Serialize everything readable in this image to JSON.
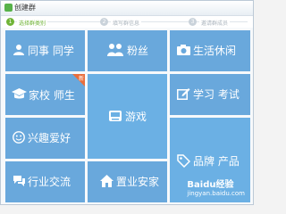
{
  "window": {
    "title": "创建群"
  },
  "steps": [
    {
      "num": "1",
      "label": "选择群类别",
      "active": true
    },
    {
      "num": "2",
      "label": "填写群信息",
      "active": false
    },
    {
      "num": "3",
      "label": "邀请群成员",
      "active": false
    }
  ],
  "tiles": {
    "colleagues": {
      "label": "同事 同学",
      "icon": "people-icon"
    },
    "fans": {
      "label": "粉丝",
      "icon": "fans-icon"
    },
    "hobbies": {
      "label": "生活休闲",
      "icon": "camera-icon"
    },
    "school": {
      "label": "家校 师生",
      "icon": "graduation-cap-icon",
      "badge": "新"
    },
    "games": {
      "label": "游戏",
      "icon": "gamepad-icon"
    },
    "study": {
      "label": "学习 考试",
      "icon": "pencil-square-icon"
    },
    "interest": {
      "label": "兴趣爱好",
      "icon": "smiley-icon"
    },
    "brand": {
      "label": "品牌 产品",
      "icon": "tag-icon"
    },
    "industry": {
      "label": "行业交流",
      "icon": "chat-bubbles-icon"
    },
    "property": {
      "label": "置业安家",
      "icon": "house-icon"
    }
  },
  "watermark": {
    "logo": "Baidu经验",
    "text": "jingyan.baidu.com"
  },
  "colors": {
    "tile": "#69a8dc",
    "step_active": "#6fb337",
    "badge": "#e96e3c"
  }
}
